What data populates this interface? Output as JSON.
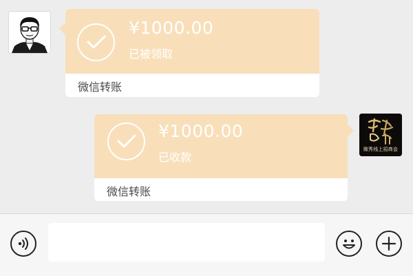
{
  "messages": [
    {
      "sender": "other",
      "avatar_icon": "cartoon-man-glasses-avatar",
      "transfer": {
        "amount": "¥1000.00",
        "status": "已被领取",
        "service": "微信转账"
      }
    },
    {
      "sender": "self",
      "avatar_icon": "brand-logo-avatar",
      "avatar_text": "微秀线上招商会",
      "transfer": {
        "amount": "¥1000.00",
        "status": "已收款",
        "service": "微信转账"
      }
    }
  ],
  "input_bar": {
    "voice_icon": "voice-icon",
    "message_value": "",
    "emoji_icon": "emoji-icon",
    "more_icon": "plus-icon"
  },
  "colors": {
    "transfer_card": "#f8dfba",
    "chat_background": "#ededed",
    "input_bar_background": "#f6f6f6"
  }
}
